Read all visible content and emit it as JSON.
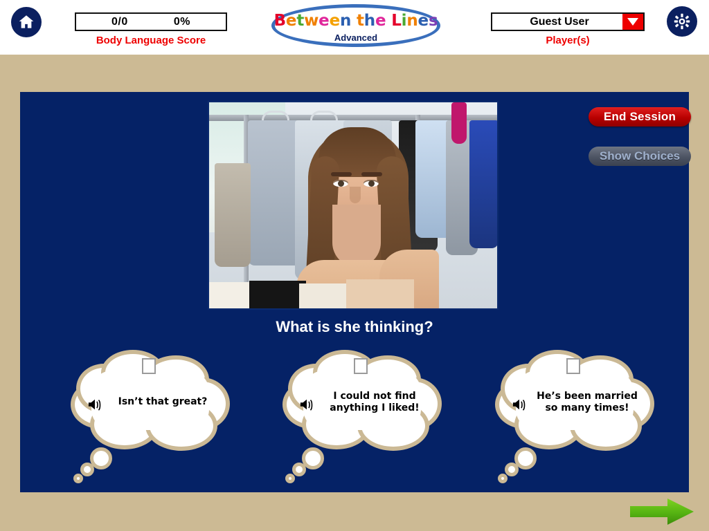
{
  "app": {
    "title": "Between the Lines",
    "subtitle": "Advanced",
    "background_color": "#ccba94",
    "panel_color": "#052266"
  },
  "header": {
    "home_icon": "home-icon",
    "gear_icon": "gear-icon",
    "score": {
      "fraction": "0/0",
      "percent": "0%",
      "caption": "Body  Language Score",
      "caption_color": "#ee0000"
    },
    "logo": {
      "letters": [
        {
          "ch": "B",
          "color": "#e4002b"
        },
        {
          "ch": "e",
          "color": "#f08000"
        },
        {
          "ch": "t",
          "color": "#4aa832"
        },
        {
          "ch": "w",
          "color": "#f08000"
        },
        {
          "ch": "e",
          "color": "#e0279b"
        },
        {
          "ch": "e",
          "color": "#f4a000"
        },
        {
          "ch": "n",
          "color": "#2b5fb0"
        },
        {
          "ch": " ",
          "color": "#000000"
        },
        {
          "ch": "t",
          "color": "#f08000"
        },
        {
          "ch": "h",
          "color": "#2b5fb0"
        },
        {
          "ch": "e",
          "color": "#e0279b"
        },
        {
          "ch": " ",
          "color": "#000000"
        },
        {
          "ch": "L",
          "color": "#e4002b"
        },
        {
          "ch": "i",
          "color": "#4aa832"
        },
        {
          "ch": "n",
          "color": "#f08000"
        },
        {
          "ch": "e",
          "color": "#2b5fb0"
        },
        {
          "ch": "s",
          "color": "#7b3fb5"
        }
      ],
      "subtitle": "Advanced",
      "oval_color": "#3a6fbc"
    },
    "player": {
      "name": "Guest User",
      "caption": "Player(s)",
      "caption_color": "#ee0000",
      "dropdown_icon": "chevron-down-icon",
      "dropdown_color": "#ee0000"
    }
  },
  "stage": {
    "end_session_label": "End Session",
    "end_session_color": "#c00000",
    "show_choices_label": "Show Choices",
    "show_choices_enabled": false,
    "question": "What is she thinking?",
    "photo_alt": "Young woman with long brown hair holding shopping bags in a clothing store",
    "choices": [
      {
        "text": "Isn’t that great?",
        "checkbox_checked": false,
        "speaker_icon": "speaker-icon"
      },
      {
        "text": "I could not find anything I liked!",
        "checkbox_checked": false,
        "speaker_icon": "speaker-icon"
      },
      {
        "text": "He’s been married so many times!",
        "checkbox_checked": false,
        "speaker_icon": "speaker-icon"
      }
    ]
  },
  "footer": {
    "next_icon": "next-arrow-icon",
    "next_color": "#4caf0a"
  }
}
